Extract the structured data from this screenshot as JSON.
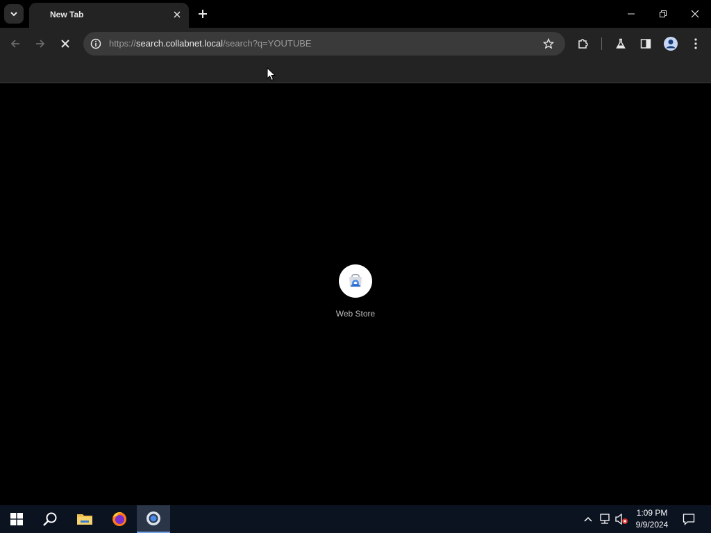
{
  "browser": {
    "tab": {
      "title": "New Tab"
    },
    "address": {
      "scheme": "https://",
      "host": "search.collabnet.local",
      "path": "/search?q=YOUTUBE"
    }
  },
  "newtab": {
    "shortcuts": [
      {
        "label": "Web Store",
        "icon": "webstore-icon"
      }
    ]
  },
  "taskbar": {
    "apps": [
      "start-icon",
      "search-icon",
      "file-explorer-icon",
      "firefox-icon",
      "chrome-icon"
    ],
    "clock": {
      "time": "1:09 PM",
      "date": "9/9/2024"
    }
  },
  "colors": {
    "accent": "#76a6e8",
    "background": "#000000",
    "toolbar": "#232323"
  }
}
